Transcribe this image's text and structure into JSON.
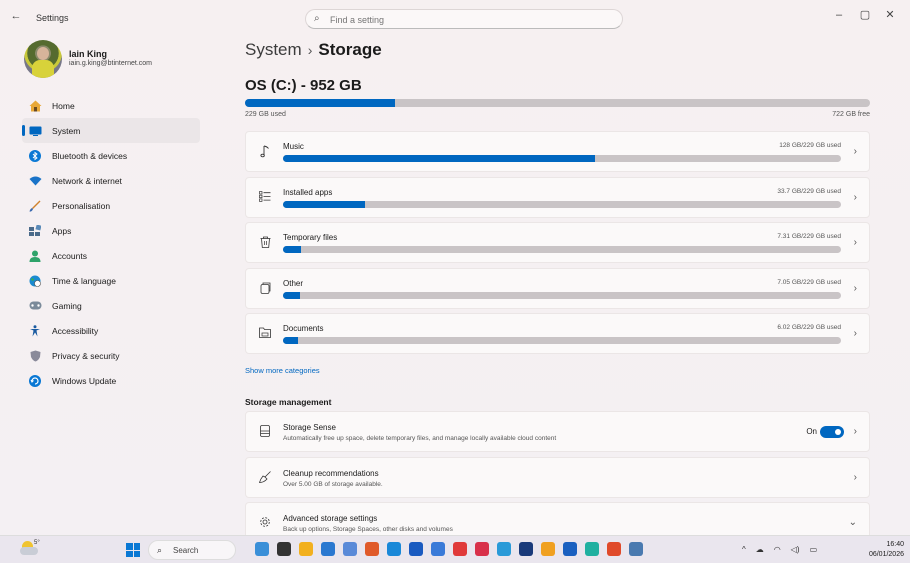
{
  "window": {
    "app_title": "Settings",
    "back_label": "←",
    "minimize": "–",
    "maximize": "▢",
    "close": "✕"
  },
  "search": {
    "placeholder": "Find a setting",
    "icon": "search-icon"
  },
  "profile": {
    "name": "Iain King",
    "email": "iain.g.king@btinternet.com"
  },
  "sidebar": {
    "items": [
      {
        "label": "Home",
        "icon": "home-icon",
        "color": "#e0a030"
      },
      {
        "label": "System",
        "icon": "system-icon",
        "color": "#0067c0",
        "active": true
      },
      {
        "label": "Bluetooth & devices",
        "icon": "bluetooth-icon",
        "color": "#0a78d4"
      },
      {
        "label": "Network & internet",
        "icon": "wifi-icon",
        "color": "#1a73c8"
      },
      {
        "label": "Personalisation",
        "icon": "brush-icon",
        "color": "#d0822c"
      },
      {
        "label": "Apps",
        "icon": "apps-icon",
        "color": "#4a6a8a"
      },
      {
        "label": "Accounts",
        "icon": "accounts-icon",
        "color": "#2ea36a"
      },
      {
        "label": "Time & language",
        "icon": "globe-clock-icon",
        "color": "#1a8ad0"
      },
      {
        "label": "Gaming",
        "icon": "gamepad-icon",
        "color": "#7a8a9a"
      },
      {
        "label": "Accessibility",
        "icon": "accessibility-icon",
        "color": "#1a5aa0"
      },
      {
        "label": "Privacy & security",
        "icon": "shield-icon",
        "color": "#8a8a9a"
      },
      {
        "label": "Windows Update",
        "icon": "update-icon",
        "color": "#0a78d4"
      }
    ]
  },
  "breadcrumb": {
    "parent": "System",
    "separator": "›",
    "current": "Storage"
  },
  "drive": {
    "title": "OS (C:) - 952 GB",
    "used_label": "229 GB used",
    "free_label": "722 GB free",
    "used_fraction": 0.24
  },
  "categories": [
    {
      "label": "Music",
      "value": "128 GB/229 GB used",
      "fraction": 0.56,
      "icon": "music-note-icon"
    },
    {
      "label": "Installed apps",
      "value": "33.7 GB/229 GB used",
      "fraction": 0.147,
      "icon": "list-icon"
    },
    {
      "label": "Temporary files",
      "value": "7.31 GB/229 GB used",
      "fraction": 0.032,
      "icon": "trash-icon"
    },
    {
      "label": "Other",
      "value": "7.05 GB/229 GB used",
      "fraction": 0.031,
      "icon": "other-files-icon"
    },
    {
      "label": "Documents",
      "value": "6.02 GB/229 GB used",
      "fraction": 0.026,
      "icon": "folder-icon"
    }
  ],
  "show_more": "Show more categories",
  "storage_management": {
    "title": "Storage management",
    "items": [
      {
        "title": "Storage Sense",
        "desc": "Automatically free up space, delete temporary files, and manage locally available cloud content",
        "icon": "storage-sense-icon",
        "toggle_label": "On",
        "chevron": "›"
      },
      {
        "title": "Cleanup recommendations",
        "desc": "Over 5.00 GB of storage available.",
        "icon": "broom-icon",
        "chevron": "›"
      },
      {
        "title": "Advanced storage settings",
        "desc": "Back up options, Storage Spaces, other disks and volumes",
        "icon": "gear-icon",
        "chevron": "⌄"
      }
    ]
  },
  "taskbar": {
    "weather_temp": "5°",
    "search_label": "Search",
    "time": "16:40",
    "date": "06/01/2026",
    "apps": [
      "#3a8fd8",
      "#333333",
      "#f2b01e",
      "#2a78d0",
      "#5a8ad8",
      "#e05a2a",
      "#1a88d8",
      "#1a5ac0",
      "#3a7ad8",
      "#e03a3a",
      "#d8304a",
      "#2a9ad8",
      "#1a3a7a",
      "#f0a020",
      "#1a60c0",
      "#20b0a0",
      "#e04a2a",
      "#4a7ab0"
    ]
  }
}
